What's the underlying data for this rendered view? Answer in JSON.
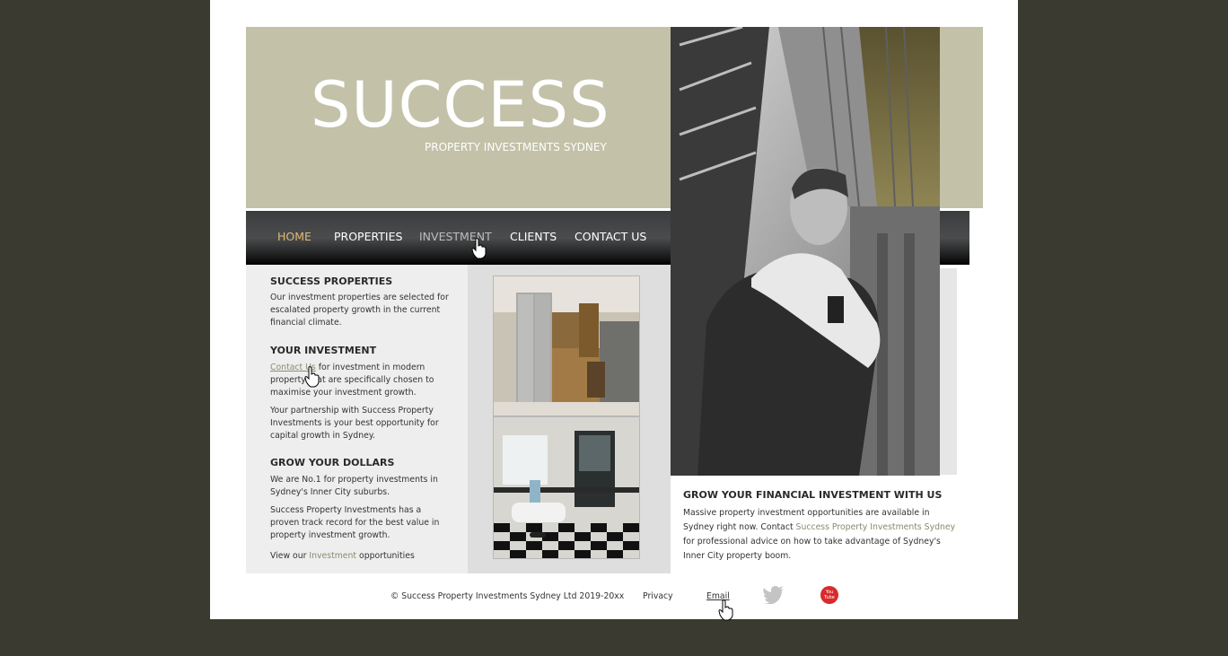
{
  "header": {
    "logo_title": "SUCCESS",
    "logo_subtitle": "PROPERTY INVESTMENTS SYDNEY"
  },
  "nav": {
    "items": [
      {
        "label": "HOME",
        "state": "active"
      },
      {
        "label": "PROPERTIES",
        "state": "normal"
      },
      {
        "label": "INVESTMENT",
        "state": "hover"
      },
      {
        "label": "CLIENTS",
        "state": "normal"
      },
      {
        "label": "CONTACT US",
        "state": "normal"
      }
    ]
  },
  "left": {
    "s1_title": "SUCCESS PROPERTIES",
    "s1_text": "Our investment properties are selected for escalated property growth in the current financial climate.",
    "s2_title": "YOUR INVESTMENT",
    "s2_link": "Contact Us",
    "s2_text_after": " for investment in modern property that are specifically chosen to maximise your investment growth.",
    "s2_text2": "Your partnership with Success Property Investments is your best opportunity for capital growth in Sydney.",
    "s3_title": "GROW YOUR DOLLARS",
    "s3_text": "We are No.1 for property investments in Sydney's Inner City suburbs.",
    "s3_text2": "Success Property Investments has a proven track record for the best value in property investment growth.",
    "s3_view_prefix": "View our ",
    "s3_view_link": "Investment",
    "s3_view_suffix": " opportunities"
  },
  "right": {
    "title": "GROW YOUR FINANCIAL INVESTMENT WITH US",
    "text_before": "Massive property investment opportunities are available in Sydney right now. Contact ",
    "text_link": "Success Property Investments Sydney",
    "text_after": " for professional advice on how to take advantage of Sydney's Inner City property boom."
  },
  "footer": {
    "copyright": "© Success Property Investments Sydney Ltd 2019-20xx",
    "privacy": "Privacy",
    "email": "Email",
    "youtube_badge": "You Tube"
  },
  "colors": {
    "page_bg": "#3a3a30",
    "banner": "#c3c1a8",
    "nav_active": "#e0b870",
    "link": "#8a8a70"
  },
  "icons": [
    "twitter-icon",
    "youtube-icon",
    "hand-cursor-icon"
  ]
}
